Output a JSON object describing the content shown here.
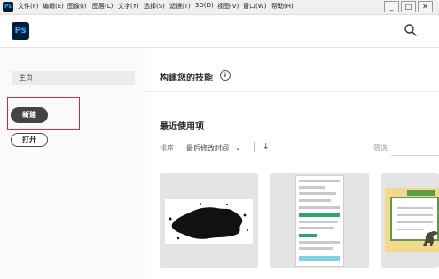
{
  "menubar": {
    "app_badge": "Ps",
    "items": [
      "文件(F)",
      "编辑(E)",
      "图像(I)",
      "图层(L)",
      "文字(Y)",
      "选择(S)",
      "滤镜(T)",
      "3D(D)",
      "视图(V)",
      "窗口(W)",
      "帮助(H)"
    ],
    "window_buttons": {
      "minimize": "_",
      "maximize": "□",
      "close": "✕"
    }
  },
  "header": {
    "logo_text": "Ps",
    "search_icon": "search-icon"
  },
  "sidebar": {
    "home_label": "主页",
    "new_label": "新建",
    "open_label": "打开"
  },
  "main": {
    "skills_title": "构建您的技能",
    "info_glyph": "i",
    "recent_title": "最近使用项",
    "sort_label": "排序",
    "sort_value": "最后修改时间",
    "sort_chevron": "⌄",
    "sort_direction": "↓",
    "filter_placeholder": "筛选"
  },
  "colors": {
    "accent_red": "#e0282d",
    "ps_dark": "#001e36",
    "ps_blue": "#31a8ff"
  }
}
